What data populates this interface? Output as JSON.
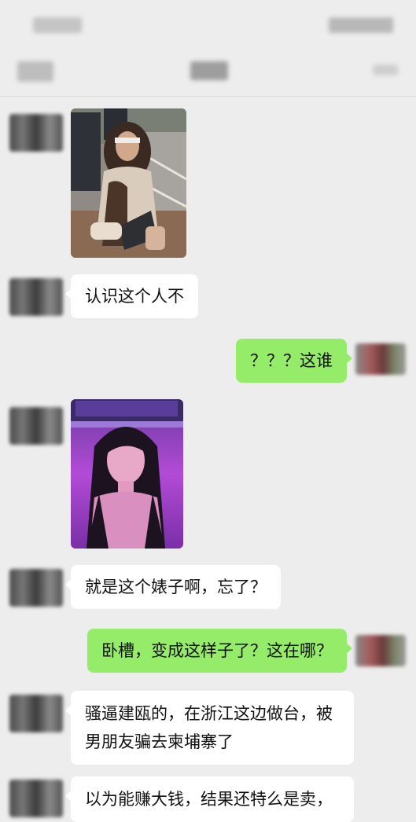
{
  "status_bar": {
    "time": "",
    "icons": ""
  },
  "nav_bar": {
    "back_label": "",
    "title": "",
    "more_icon": "more-icon"
  },
  "messages": [
    {
      "from": "contact",
      "kind": "image",
      "description_icon": "photo-woman-street"
    },
    {
      "from": "contact",
      "kind": "text",
      "text": "认识这个人不"
    },
    {
      "from": "me",
      "kind": "text",
      "text": "？？？这谁"
    },
    {
      "from": "contact",
      "kind": "image",
      "description_icon": "photo-woman-selfie-purple"
    },
    {
      "from": "contact",
      "kind": "text",
      "text": "就是这个婊子啊，忘了？"
    },
    {
      "from": "me",
      "kind": "text",
      "text": "卧槽，变成这样子了？这在哪？"
    },
    {
      "from": "contact",
      "kind": "text",
      "text": "骚逼建瓯的，在浙江这边做台，被男朋友骗去柬埔寨了"
    },
    {
      "from": "contact",
      "kind": "text",
      "text": "以为能赚大钱，结果还特么是卖，"
    }
  ],
  "colors": {
    "background": "#ededed",
    "incoming_bubble": "#ffffff",
    "outgoing_bubble": "#95ec69"
  }
}
